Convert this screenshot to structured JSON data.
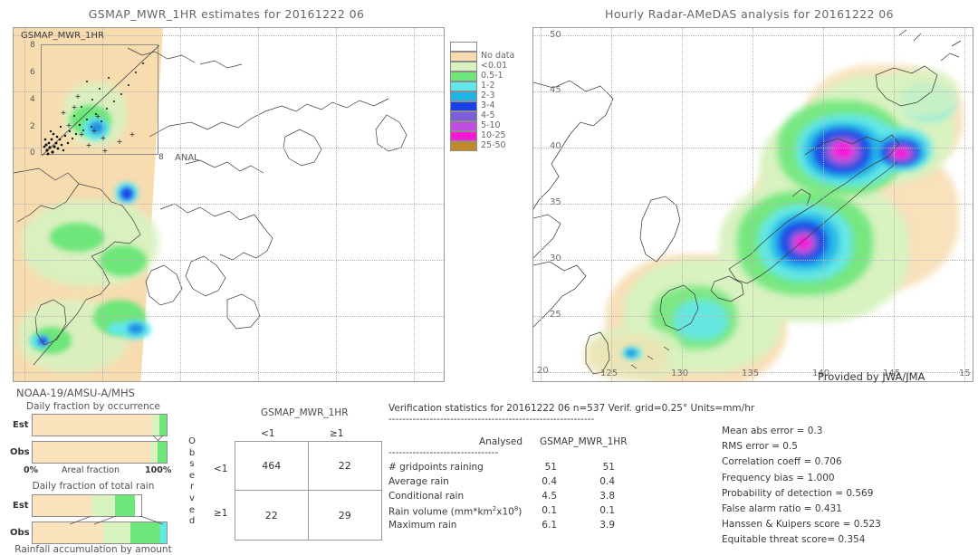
{
  "left_panel": {
    "title": "GSMAP_MWR_1HR estimates for 20161222 06",
    "inset_label": "GSMAP_MWR_1HR",
    "inset_x_label": "ANAL",
    "inset_x_max": "8",
    "inset_y_ticks": [
      "8",
      "6",
      "4",
      "2",
      "0"
    ],
    "satellite": "NOAA-19/AMSU-A/MHS"
  },
  "right_panel": {
    "title": "Hourly Radar-AMeDAS analysis for 20161222 06",
    "credit": "Provided by JWA/JMA",
    "lon_ticks": [
      "20",
      "125",
      "130",
      "135",
      "140",
      "145",
      "15"
    ],
    "lat_ticks": [
      "50",
      "45",
      "40",
      "35",
      "30",
      "25",
      "20"
    ],
    "corner_label": "20"
  },
  "colorbar": {
    "entries": [
      {
        "label": "",
        "color": "#ffffff"
      },
      {
        "label": "No data",
        "color": "#f7dcb0"
      },
      {
        "label": "<0.01",
        "color": "#d8f2c0"
      },
      {
        "label": "0.5-1",
        "color": "#6ee67a"
      },
      {
        "label": "1-2",
        "color": "#63e8ea"
      },
      {
        "label": "2-3",
        "color": "#22b4e8"
      },
      {
        "label": "3-4",
        "color": "#1841e8"
      },
      {
        "label": "4-5",
        "color": "#7b5fd8"
      },
      {
        "label": "5-10",
        "color": "#c04fe0"
      },
      {
        "label": "10-25",
        "color": "#f718d8"
      },
      {
        "label": "25-50",
        "color": "#c08a2a"
      }
    ]
  },
  "fraction_panels": {
    "occurrence": {
      "title": "Daily fraction by occurrence",
      "est_label": "Est",
      "obs_label": "Obs",
      "axis_left": "0%",
      "axis_center": "Areal fraction",
      "axis_right": "100%",
      "est_segments": [
        {
          "color": "#fae3bd",
          "pct": 89.5
        },
        {
          "color": "#d8f2c0",
          "pct": 5.0
        },
        {
          "color": "#6ee67a",
          "pct": 5.5
        }
      ],
      "obs_segments": [
        {
          "color": "#fae3bd",
          "pct": 88.0
        },
        {
          "color": "#d8f2c0",
          "pct": 5.5
        },
        {
          "color": "#6ee67a",
          "pct": 6.5
        }
      ]
    },
    "total_rain": {
      "title": "Daily fraction of total rain",
      "est_label": "Est",
      "obs_label": "Obs",
      "caption": "Rainfall accumulation by amount",
      "est_segments": [
        {
          "color": "#fae3bd",
          "pct": 54.0
        },
        {
          "color": "#d8f2c0",
          "pct": 22.0
        },
        {
          "color": "#6ee67a",
          "pct": 18.0
        }
      ],
      "obs_segments": [
        {
          "color": "#fae3bd",
          "pct": 53.0
        },
        {
          "color": "#d8f2c0",
          "pct": 20.0
        },
        {
          "color": "#6ee67a",
          "pct": 22.0
        },
        {
          "color": "#63e8ea",
          "pct": 5.0
        }
      ]
    }
  },
  "contingency": {
    "title": "GSMAP_MWR_1HR",
    "col_headers": [
      "<1",
      "≥1"
    ],
    "row_headers": [
      "<1",
      "≥1"
    ],
    "side_label": "Observed",
    "cells": [
      "464",
      "22",
      "22",
      "29"
    ]
  },
  "verification": {
    "header": "Verification statistics for 20161222 06  n=537  Verif. grid=0.25°  Units=mm/hr",
    "divider": "------------------------------------------------------------",
    "col_headers": [
      "Analysed",
      "GSMAP_MWR_1HR"
    ],
    "sub_divider": "--------------------------------",
    "rows": [
      {
        "name": "# gridpoints raining",
        "analysed": "51",
        "estimate": "51"
      },
      {
        "name": "Average rain",
        "analysed": "0.4",
        "estimate": "0.4"
      },
      {
        "name": "Conditional rain",
        "analysed": "4.5",
        "estimate": "3.8"
      },
      {
        "name": "Rain volume (mm*km²x10⁸)",
        "analysed": "0.1",
        "estimate": "0.1"
      },
      {
        "name": "Maximum rain",
        "analysed": "6.1",
        "estimate": "3.9"
      }
    ],
    "scores": [
      "Mean abs error = 0.3",
      "RMS error = 0.5",
      "Correlation coeff = 0.706",
      "Frequency bias = 1.000",
      "Probability of detection = 0.569",
      "False alarm ratio = 0.431",
      "Hanssen & Kuipers score = 0.523",
      "Equitable threat score= 0.354"
    ]
  }
}
